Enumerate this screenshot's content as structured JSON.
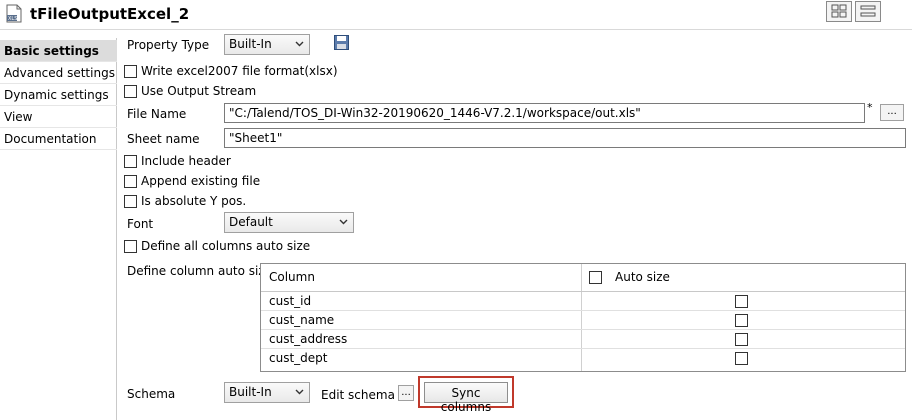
{
  "header": {
    "title": "tFileOutputExcel_2"
  },
  "sidebar": {
    "items": [
      {
        "label": "Basic settings"
      },
      {
        "label": "Advanced settings"
      },
      {
        "label": "Dynamic settings"
      },
      {
        "label": "View"
      },
      {
        "label": "Documentation"
      }
    ]
  },
  "form": {
    "property_type": {
      "label": "Property Type",
      "value": "Built-In"
    },
    "write_excel2007": {
      "label": "Write excel2007 file format(xlsx)",
      "checked": false
    },
    "use_output_stream": {
      "label": "Use Output Stream",
      "checked": false
    },
    "file_name": {
      "label": "File Name",
      "value": "\"C:/Talend/TOS_DI-Win32-20190620_1446-V7.2.1/workspace/out.xls\"",
      "marker": "*",
      "browse": "..."
    },
    "sheet_name": {
      "label": "Sheet name",
      "value": "\"Sheet1\""
    },
    "include_header": {
      "label": "Include header",
      "checked": false
    },
    "append_existing": {
      "label": "Append existing file",
      "checked": false
    },
    "absolute_y": {
      "label": "Is absolute Y pos.",
      "checked": false
    },
    "font": {
      "label": "Font",
      "value": "Default"
    },
    "define_all_auto_size": {
      "label": "Define all columns auto size",
      "checked": false
    },
    "column_auto_size": {
      "label": "Define column auto size",
      "headers": {
        "column": "Column",
        "auto_size": "Auto size"
      },
      "rows": [
        {
          "column": "cust_id",
          "auto_size": false
        },
        {
          "column": "cust_name",
          "auto_size": false
        },
        {
          "column": "cust_address",
          "auto_size": false
        },
        {
          "column": "cust_dept",
          "auto_size": false
        }
      ]
    },
    "schema": {
      "label": "Schema",
      "value": "Built-In",
      "edit_label": "Edit schema",
      "edit_btn": "...",
      "sync_btn": "Sync columns"
    }
  },
  "colors": {
    "highlight_border": "#c0392b",
    "sidebar_active_bg": "#dcdcdc"
  }
}
